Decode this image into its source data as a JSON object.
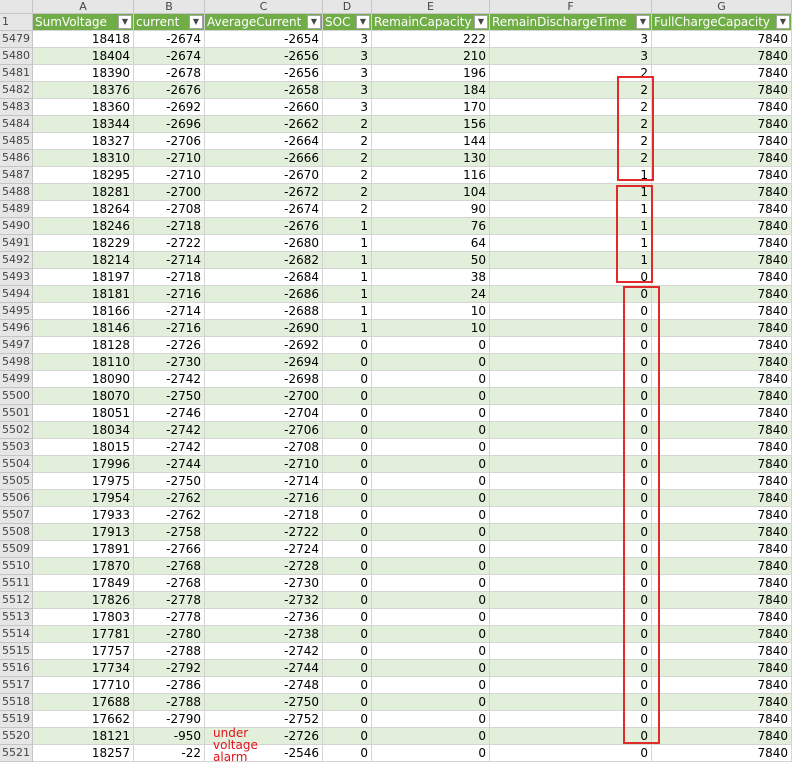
{
  "columns": [
    {
      "letter": "A",
      "header": "SumVoltage"
    },
    {
      "letter": "B",
      "header": "current"
    },
    {
      "letter": "C",
      "header": "AverageCurrent"
    },
    {
      "letter": "D",
      "header": "SOC"
    },
    {
      "letter": "E",
      "header": "RemainCapacity"
    },
    {
      "letter": "F",
      "header": "RemainDischargeTime"
    },
    {
      "letter": "G",
      "header": "FullChargeCapacity"
    }
  ],
  "header_row_number": "1",
  "filter_icon": "dropdown-arrow-icon",
  "colors": {
    "header_fill": "#70ad47",
    "band_fill": "#e2efda",
    "highlight_box": "#e02b2b",
    "annotation_text": "#e0121a"
  },
  "rows": [
    [
      "5479",
      "18418",
      "-2674",
      "-2654",
      "3",
      "222",
      "3",
      "7840"
    ],
    [
      "5480",
      "18404",
      "-2674",
      "-2656",
      "3",
      "210",
      "3",
      "7840"
    ],
    [
      "5481",
      "18390",
      "-2678",
      "-2656",
      "3",
      "196",
      "2",
      "7840"
    ],
    [
      "5482",
      "18376",
      "-2676",
      "-2658",
      "3",
      "184",
      "2",
      "7840"
    ],
    [
      "5483",
      "18360",
      "-2692",
      "-2660",
      "3",
      "170",
      "2",
      "7840"
    ],
    [
      "5484",
      "18344",
      "-2696",
      "-2662",
      "2",
      "156",
      "2",
      "7840"
    ],
    [
      "5485",
      "18327",
      "-2706",
      "-2664",
      "2",
      "144",
      "2",
      "7840"
    ],
    [
      "5486",
      "18310",
      "-2710",
      "-2666",
      "2",
      "130",
      "2",
      "7840"
    ],
    [
      "5487",
      "18295",
      "-2710",
      "-2670",
      "2",
      "116",
      "1",
      "7840"
    ],
    [
      "5488",
      "18281",
      "-2700",
      "-2672",
      "2",
      "104",
      "1",
      "7840"
    ],
    [
      "5489",
      "18264",
      "-2708",
      "-2674",
      "2",
      "90",
      "1",
      "7840"
    ],
    [
      "5490",
      "18246",
      "-2718",
      "-2676",
      "1",
      "76",
      "1",
      "7840"
    ],
    [
      "5491",
      "18229",
      "-2722",
      "-2680",
      "1",
      "64",
      "1",
      "7840"
    ],
    [
      "5492",
      "18214",
      "-2714",
      "-2682",
      "1",
      "50",
      "1",
      "7840"
    ],
    [
      "5493",
      "18197",
      "-2718",
      "-2684",
      "1",
      "38",
      "0",
      "7840"
    ],
    [
      "5494",
      "18181",
      "-2716",
      "-2686",
      "1",
      "24",
      "0",
      "7840"
    ],
    [
      "5495",
      "18166",
      "-2714",
      "-2688",
      "1",
      "10",
      "0",
      "7840"
    ],
    [
      "5496",
      "18146",
      "-2716",
      "-2690",
      "1",
      "10",
      "0",
      "7840"
    ],
    [
      "5497",
      "18128",
      "-2726",
      "-2692",
      "0",
      "0",
      "0",
      "7840"
    ],
    [
      "5498",
      "18110",
      "-2730",
      "-2694",
      "0",
      "0",
      "0",
      "7840"
    ],
    [
      "5499",
      "18090",
      "-2742",
      "-2698",
      "0",
      "0",
      "0",
      "7840"
    ],
    [
      "5500",
      "18070",
      "-2750",
      "-2700",
      "0",
      "0",
      "0",
      "7840"
    ],
    [
      "5501",
      "18051",
      "-2746",
      "-2704",
      "0",
      "0",
      "0",
      "7840"
    ],
    [
      "5502",
      "18034",
      "-2742",
      "-2706",
      "0",
      "0",
      "0",
      "7840"
    ],
    [
      "5503",
      "18015",
      "-2742",
      "-2708",
      "0",
      "0",
      "0",
      "7840"
    ],
    [
      "5504",
      "17996",
      "-2744",
      "-2710",
      "0",
      "0",
      "0",
      "7840"
    ],
    [
      "5505",
      "17975",
      "-2750",
      "-2714",
      "0",
      "0",
      "0",
      "7840"
    ],
    [
      "5506",
      "17954",
      "-2762",
      "-2716",
      "0",
      "0",
      "0",
      "7840"
    ],
    [
      "5507",
      "17933",
      "-2762",
      "-2718",
      "0",
      "0",
      "0",
      "7840"
    ],
    [
      "5508",
      "17913",
      "-2758",
      "-2722",
      "0",
      "0",
      "0",
      "7840"
    ],
    [
      "5509",
      "17891",
      "-2766",
      "-2724",
      "0",
      "0",
      "0",
      "7840"
    ],
    [
      "5510",
      "17870",
      "-2768",
      "-2728",
      "0",
      "0",
      "0",
      "7840"
    ],
    [
      "5511",
      "17849",
      "-2768",
      "-2730",
      "0",
      "0",
      "0",
      "7840"
    ],
    [
      "5512",
      "17826",
      "-2778",
      "-2732",
      "0",
      "0",
      "0",
      "7840"
    ],
    [
      "5513",
      "17803",
      "-2778",
      "-2736",
      "0",
      "0",
      "0",
      "7840"
    ],
    [
      "5514",
      "17781",
      "-2780",
      "-2738",
      "0",
      "0",
      "0",
      "7840"
    ],
    [
      "5515",
      "17757",
      "-2788",
      "-2742",
      "0",
      "0",
      "0",
      "7840"
    ],
    [
      "5516",
      "17734",
      "-2792",
      "-2744",
      "0",
      "0",
      "0",
      "7840"
    ],
    [
      "5517",
      "17710",
      "-2786",
      "-2748",
      "0",
      "0",
      "0",
      "7840"
    ],
    [
      "5518",
      "17688",
      "-2788",
      "-2750",
      "0",
      "0",
      "0",
      "7840"
    ],
    [
      "5519",
      "17662",
      "-2790",
      "-2752",
      "0",
      "0",
      "0",
      "7840"
    ],
    [
      "5520",
      "18121",
      "-950",
      "-2726",
      "0",
      "0",
      "0",
      "7840"
    ],
    [
      "5521",
      "18257",
      "-22",
      "-2546",
      "0",
      "0",
      "0",
      "7840"
    ]
  ],
  "annotation": {
    "lines": [
      "under",
      "voltage",
      "alarm"
    ]
  }
}
